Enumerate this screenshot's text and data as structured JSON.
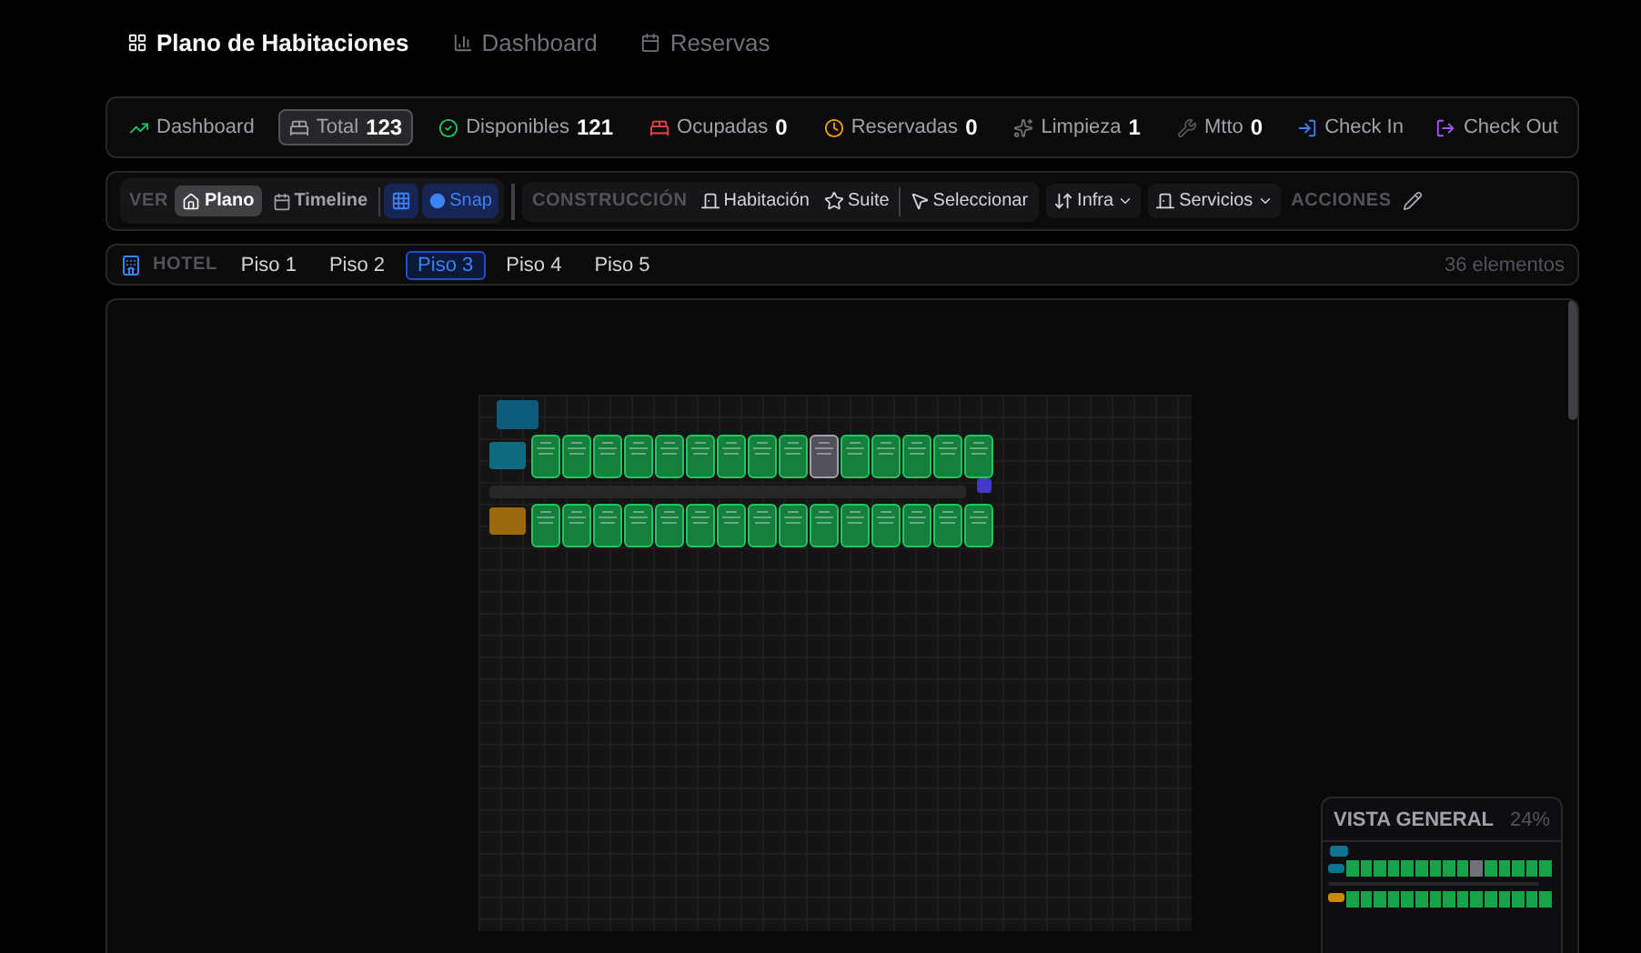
{
  "nav": [
    {
      "label": "Plano de Habitaciones",
      "selected": true
    },
    {
      "label": "Dashboard",
      "selected": false
    },
    {
      "label": "Reservas",
      "selected": false
    }
  ],
  "stats": [
    {
      "kind": "link",
      "label": "Dashboard"
    },
    {
      "kind": "stat",
      "label": "Total",
      "value": "123",
      "selected": true
    },
    {
      "kind": "stat",
      "label": "Disponibles",
      "value": "121",
      "selected": false
    },
    {
      "kind": "stat",
      "label": "Ocupadas",
      "value": "0",
      "selected": false
    },
    {
      "kind": "stat",
      "label": "Reservadas",
      "value": "0",
      "selected": false
    },
    {
      "kind": "stat",
      "label": "Limpieza",
      "value": "1",
      "selected": false
    },
    {
      "kind": "stat",
      "label": "Mtto",
      "value": "0",
      "selected": false
    },
    {
      "kind": "link",
      "label": "Check In"
    },
    {
      "kind": "link",
      "label": "Check Out"
    }
  ],
  "toolbar": {
    "view_label": "VER",
    "views": [
      {
        "label": "Plano",
        "selected": true
      },
      {
        "label": "Timeline",
        "selected": false
      }
    ],
    "grid_on": true,
    "snap": {
      "label": "Snap",
      "on": true
    },
    "build_label": "CONSTRUCCIÓN",
    "build_tools": [
      {
        "label": "Habitación"
      },
      {
        "label": "Suite"
      },
      {
        "label": "Seleccionar"
      }
    ],
    "menus": [
      {
        "label": "Infra"
      },
      {
        "label": "Servicios"
      }
    ],
    "actions_label": "ACCIONES"
  },
  "floors": {
    "label": "HOTEL",
    "items": [
      {
        "label": "Piso 1",
        "selected": false
      },
      {
        "label": "Piso 2",
        "selected": false
      },
      {
        "label": "Piso 3",
        "selected": true
      },
      {
        "label": "Piso 4",
        "selected": false
      },
      {
        "label": "Piso 5",
        "selected": false
      }
    ],
    "count": "36 elementos"
  },
  "plan": {
    "rows": [
      [
        {
          "kind": "available"
        },
        {
          "kind": "available"
        },
        {
          "kind": "available"
        },
        {
          "kind": "available"
        },
        {
          "kind": "available"
        },
        {
          "kind": "available"
        },
        {
          "kind": "available"
        },
        {
          "kind": "available"
        },
        {
          "kind": "available"
        },
        {
          "kind": "cleaning"
        },
        {
          "kind": "available"
        },
        {
          "kind": "available"
        },
        {
          "kind": "available"
        },
        {
          "kind": "available"
        },
        {
          "kind": "available"
        }
      ],
      [
        {
          "kind": "available"
        },
        {
          "kind": "available"
        },
        {
          "kind": "available"
        },
        {
          "kind": "available"
        },
        {
          "kind": "available"
        },
        {
          "kind": "available"
        },
        {
          "kind": "available"
        },
        {
          "kind": "available"
        },
        {
          "kind": "available"
        },
        {
          "kind": "available"
        },
        {
          "kind": "available"
        },
        {
          "kind": "available"
        },
        {
          "kind": "available"
        },
        {
          "kind": "available"
        },
        {
          "kind": "available"
        }
      ]
    ]
  },
  "overview": {
    "title": "VISTA GENERAL",
    "zoom": "24%"
  }
}
